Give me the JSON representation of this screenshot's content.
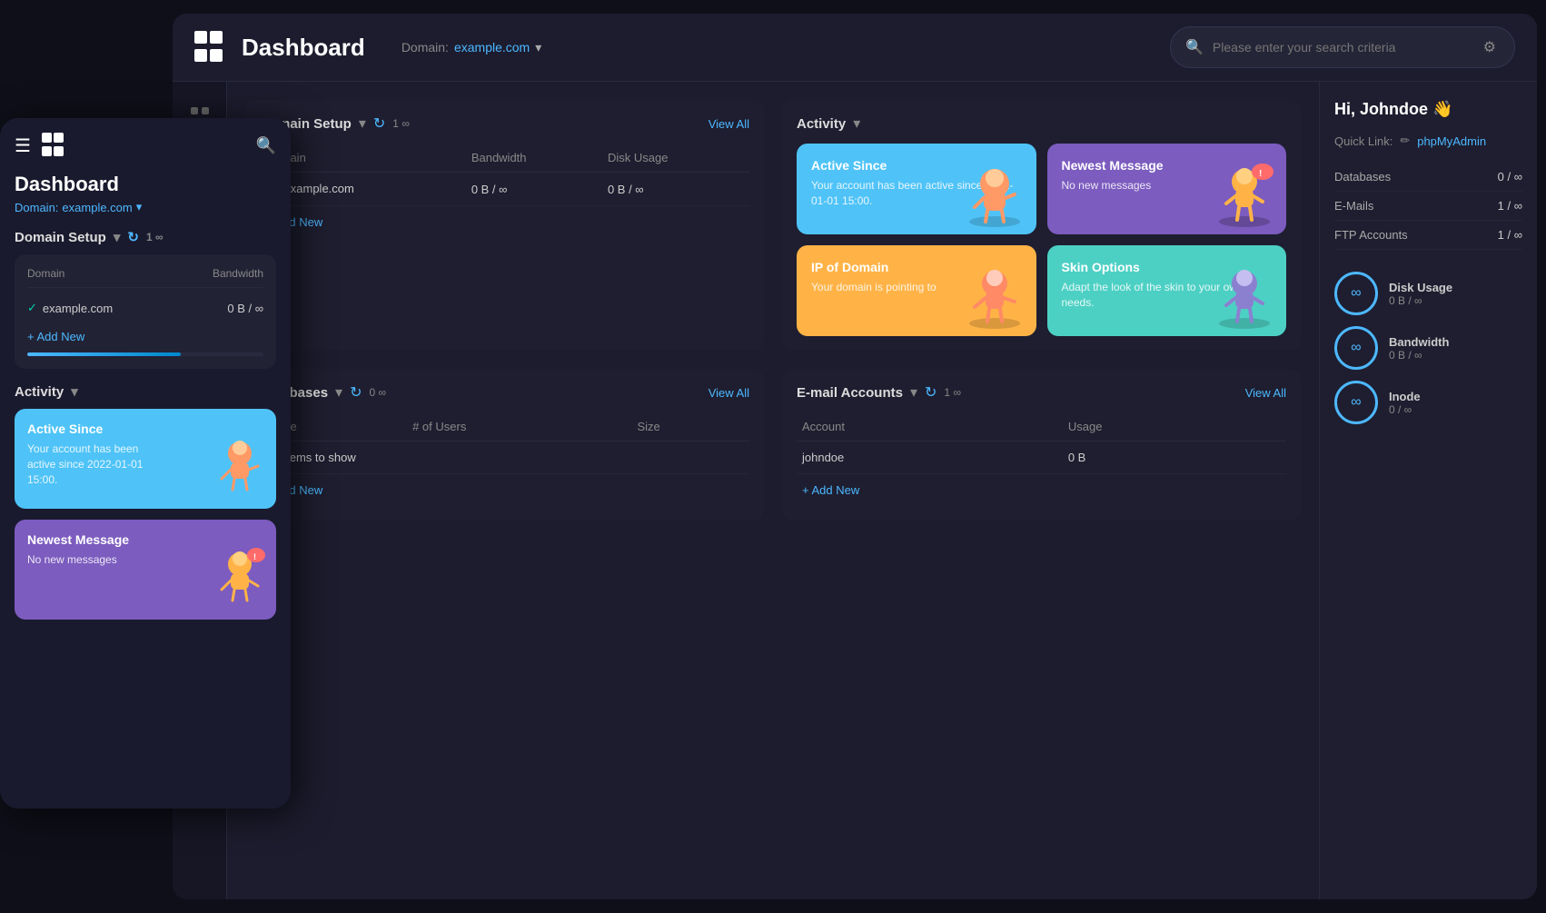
{
  "app": {
    "title": "Dashboard",
    "logo_alt": "logo"
  },
  "header": {
    "domain_label": "Domain:",
    "domain_value": "example.com",
    "search_placeholder": "Please enter your search criteria"
  },
  "domain_setup": {
    "section_title": "Domain Setup",
    "count": "1",
    "infinity": "∞",
    "view_all": "View All",
    "columns": [
      "Domain",
      "Bandwidth",
      "Disk Usage"
    ],
    "rows": [
      {
        "domain": "example.com",
        "bandwidth": "0 B / ∞",
        "disk": "0 B / ∞"
      }
    ],
    "add_new": "+ Add New"
  },
  "activity": {
    "section_title": "Activity",
    "cards": [
      {
        "id": "active-since",
        "title": "Active Since",
        "text": "Your account has been active since 2022-01-01 15:00.",
        "color": "blue"
      },
      {
        "id": "newest-message",
        "title": "Newest Message",
        "text": "No new messages",
        "color": "purple"
      },
      {
        "id": "ip-of-domain",
        "title": "IP of Domain",
        "text": "Your domain is pointing to",
        "color": "orange"
      },
      {
        "id": "skin-options",
        "title": "Skin Options",
        "text": "Adapt the look of the skin to your own needs.",
        "color": "teal"
      }
    ]
  },
  "databases": {
    "section_title": "Databases",
    "count": "0",
    "infinity": "∞",
    "view_all": "View All",
    "columns": [
      "Name",
      "# of Users",
      "Size"
    ],
    "no_data": "No items to show",
    "add_new": "+ Add New"
  },
  "email_accounts": {
    "section_title": "E-mail Accounts",
    "count": "1",
    "infinity": "∞",
    "view_all": "View All",
    "columns": [
      "Account",
      "Usage"
    ],
    "rows": [
      {
        "account": "johndoe",
        "usage": "0 B"
      }
    ],
    "add_new": "+ Add New"
  },
  "right_panel": {
    "greeting": "Hi, Johndoe 👋",
    "quick_link_label": "Quick Link:",
    "quick_link_value": "phpMyAdmin",
    "stats": [
      {
        "label": "Databases",
        "value": "0 / ∞"
      },
      {
        "label": "E-Mails",
        "value": "1 / ∞"
      },
      {
        "label": "FTP Accounts",
        "value": "1 / ∞"
      }
    ],
    "gauges": [
      {
        "title": "Disk Usage",
        "value": "0 B / ∞"
      },
      {
        "title": "Bandwidth",
        "value": "0 B / ∞"
      },
      {
        "title": "Inode",
        "value": "0 / ∞"
      }
    ]
  },
  "mobile": {
    "title": "Dashboard",
    "domain_label": "Domain:",
    "domain_value": "example.com",
    "domain_setup_title": "Domain Setup",
    "activity_title": "Activity",
    "table_header_domain": "Domain",
    "table_header_bandwidth": "Bandwidth",
    "domain_row": "example.com",
    "bandwidth_row": "0 B / ∞",
    "add_new": "+ Add New",
    "active_since_title": "Active Since",
    "active_since_text": "Your account has been active since 2022-01-01 15:00.",
    "newest_msg_title": "Newest Message",
    "newest_msg_text": "No new messages"
  },
  "icons": {
    "search": "🔍",
    "filter": "⚙",
    "refresh": "↻",
    "chevron_down": "▾",
    "infinity": "∞",
    "check": "✓",
    "plus": "+",
    "hamburger": "☰",
    "apps": "⊞",
    "edit": "✏"
  }
}
